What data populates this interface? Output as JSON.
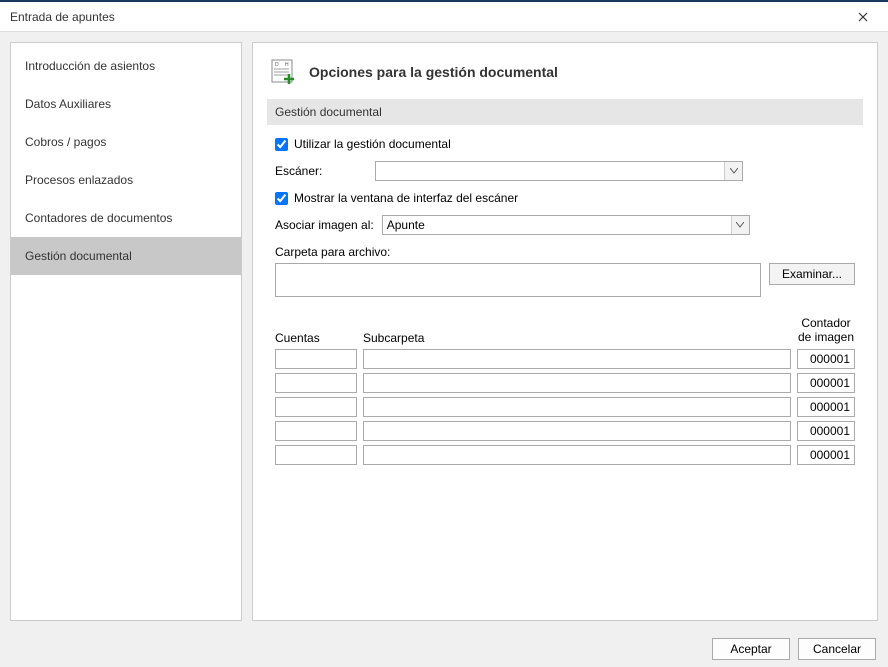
{
  "window": {
    "title": "Entrada de apuntes"
  },
  "nav": {
    "items": [
      {
        "label": "Introducción de asientos"
      },
      {
        "label": "Datos Auxiliares"
      },
      {
        "label": "Cobros / pagos"
      },
      {
        "label": "Procesos enlazados"
      },
      {
        "label": "Contadores de documentos"
      },
      {
        "label": "Gestión documental"
      }
    ],
    "selected_index": 5
  },
  "panel": {
    "title": "Opciones para la gestión documental",
    "section_header": "Gestión documental",
    "use_doc_mgmt_label": "Utilizar la gestión documental",
    "use_doc_mgmt_checked": true,
    "scanner_label": "Escáner:",
    "scanner_value": "",
    "show_scanner_ui_label": "Mostrar la ventana de interfaz del escáner",
    "show_scanner_ui_checked": true,
    "associate_label": "Asociar imagen al:",
    "associate_value": "Apunte",
    "folder_label": "Carpeta para archivo:",
    "folder_value": "",
    "browse_label": "Examinar...",
    "table": {
      "headers": {
        "cuentas": "Cuentas",
        "subcarpeta": "Subcarpeta",
        "contador": "Contador de imagen"
      },
      "rows": [
        {
          "cuenta": "",
          "subcarpeta": "",
          "contador": "000001"
        },
        {
          "cuenta": "",
          "subcarpeta": "",
          "contador": "000001"
        },
        {
          "cuenta": "",
          "subcarpeta": "",
          "contador": "000001"
        },
        {
          "cuenta": "",
          "subcarpeta": "",
          "contador": "000001"
        },
        {
          "cuenta": "",
          "subcarpeta": "",
          "contador": "000001"
        }
      ]
    }
  },
  "footer": {
    "accept": "Aceptar",
    "cancel": "Cancelar"
  }
}
